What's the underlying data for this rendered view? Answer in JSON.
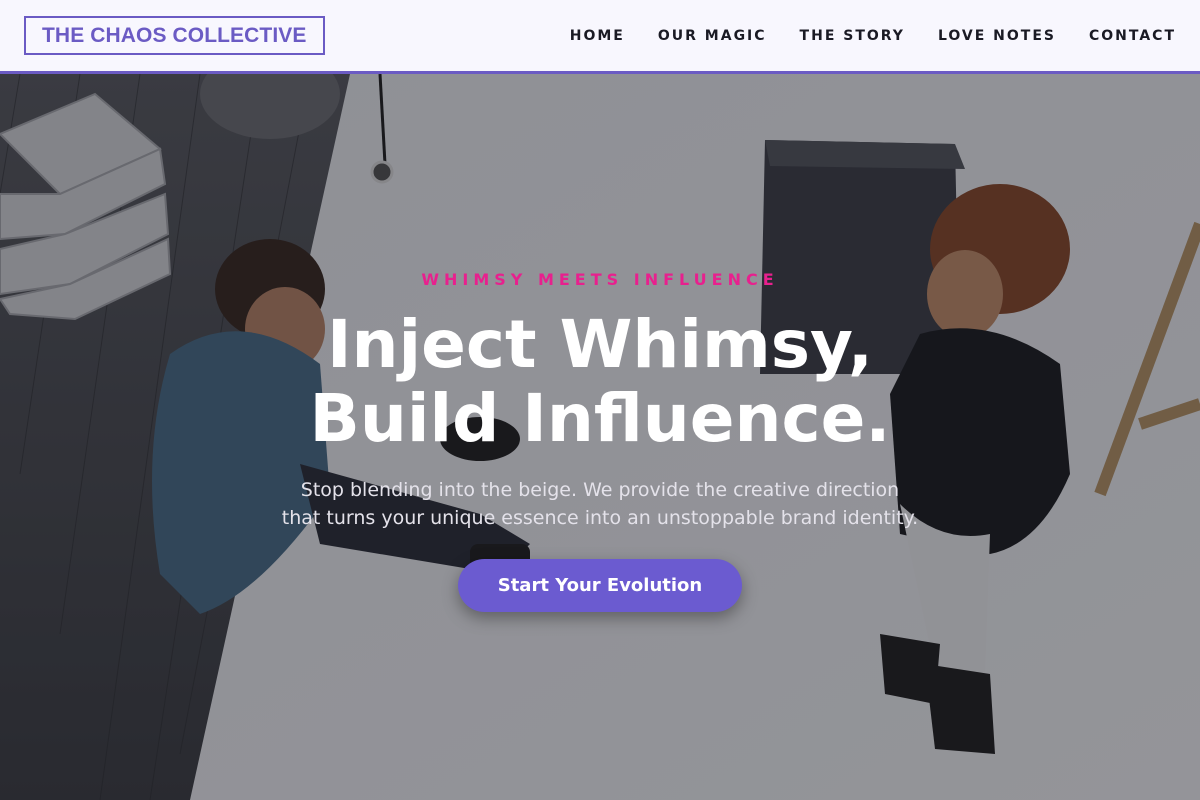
{
  "brand": {
    "logo_text": "THE CHAOS COLLECTIVE",
    "accent_color": "#6b5bc4"
  },
  "nav": {
    "items": [
      {
        "label": "HOME"
      },
      {
        "label": "OUR MAGIC"
      },
      {
        "label": "THE STORY"
      },
      {
        "label": "LOVE NOTES"
      },
      {
        "label": "CONTACT"
      }
    ]
  },
  "hero": {
    "eyebrow": "WHIMSY MEETS INFLUENCE",
    "eyebrow_color": "#e8208e",
    "headline_line1": "Inject Whimsy,",
    "headline_line2": "Build Influence.",
    "subtext_line1": "Stop blending into the beige. We provide the creative direction",
    "subtext_line2": "that turns your unique essence into an unstoppable brand identity.",
    "cta_label": "Start Your Evolution",
    "cta_color": "#6b5bd0",
    "background_image": "photo-two-people-sitting-on-studio-floor"
  }
}
